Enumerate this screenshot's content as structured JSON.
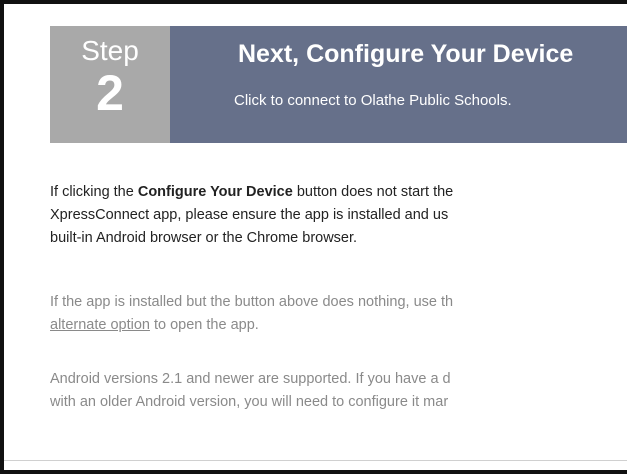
{
  "step": {
    "word": "Step",
    "number": "2",
    "title": "Next, Configure Your Device",
    "subtitle": "Click to connect to Olathe Public Schools."
  },
  "paragraph1": {
    "line1_pre": "If clicking the ",
    "line1_bold": "Configure Your Device",
    "line1_post": " button does not start the",
    "line2": "XpressConnect app, please ensure the app is installed and us",
    "line3": "built-in Android browser or the Chrome browser."
  },
  "paragraph2": {
    "line1": "If the app is installed but the button above does nothing, use th",
    "link": "alternate option",
    "line2_post": " to open the app."
  },
  "paragraph3": {
    "line1": "Android versions 2.1 and newer are supported. If you have a d",
    "line2": "with an older Android version, you will need to configure it mar"
  },
  "colors": {
    "step_box": "#a9a9a9",
    "step_banner": "#66708a",
    "body_text": "#222222",
    "muted_text": "#8a8a8a"
  }
}
